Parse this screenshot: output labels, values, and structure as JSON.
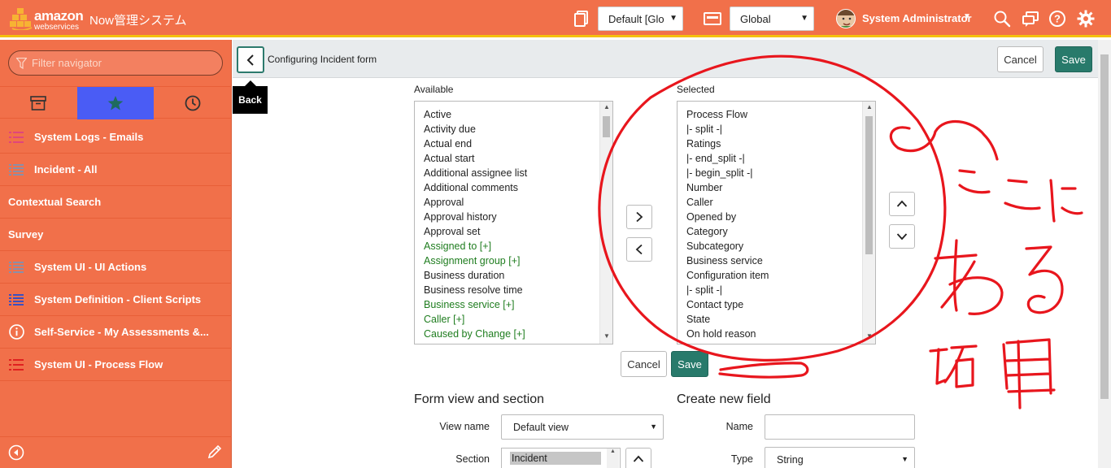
{
  "header": {
    "logo_word": "amazon",
    "logo_sub": "webservices",
    "app_title": "Now管理システム",
    "update_set": "Default [Glo",
    "application_scope": "Global",
    "user_name": "System Administrator"
  },
  "sidebar": {
    "filter_placeholder": "Filter navigator",
    "tabs": [
      {
        "icon": "archive-icon"
      },
      {
        "icon": "star-icon",
        "active": true
      },
      {
        "icon": "clock-icon"
      }
    ],
    "items": [
      {
        "label": "System Logs - Emails",
        "icon": "list-icon",
        "icon_color": "#e0457b"
      },
      {
        "label": "Incident - All",
        "icon": "list-icon",
        "icon_color": "#8a8fa8"
      },
      {
        "label": "Contextual Search",
        "icon": ""
      },
      {
        "label": "Survey",
        "icon": ""
      },
      {
        "label": "System UI - UI Actions",
        "icon": "list-icon",
        "icon_color": "#8a8fa8"
      },
      {
        "label": "System Definition - Client Scripts",
        "icon": "list-icon",
        "icon_color": "#3b4fc0"
      },
      {
        "label": "Self-Service - My Assessments &...",
        "icon": "info-icon",
        "icon_color": "#ffffff"
      },
      {
        "label": "System UI - Process Flow",
        "icon": "list-icon",
        "icon_color": "#e02020"
      }
    ]
  },
  "main": {
    "back_tooltip": "Back",
    "form_title": "Configuring Incident form",
    "cancel_label": "Cancel",
    "save_label": "Save",
    "available_label": "Available",
    "selected_label": "Selected",
    "available": [
      {
        "text": "Active",
        "ref": false
      },
      {
        "text": "Activity due",
        "ref": false
      },
      {
        "text": "Actual end",
        "ref": false
      },
      {
        "text": "Actual start",
        "ref": false
      },
      {
        "text": "Additional assignee list",
        "ref": false
      },
      {
        "text": "Additional comments",
        "ref": false
      },
      {
        "text": "Approval",
        "ref": false
      },
      {
        "text": "Approval history",
        "ref": false
      },
      {
        "text": "Approval set",
        "ref": false
      },
      {
        "text": "Assigned to [+]",
        "ref": true
      },
      {
        "text": "Assignment group [+]",
        "ref": true
      },
      {
        "text": "Business duration",
        "ref": false
      },
      {
        "text": "Business resolve time",
        "ref": false
      },
      {
        "text": "Business service [+]",
        "ref": true
      },
      {
        "text": "Caller [+]",
        "ref": true
      },
      {
        "text": "Caused by Change [+]",
        "ref": true
      }
    ],
    "selected": [
      "Process Flow",
      "|- split -|",
      "Ratings",
      "|- end_split -|",
      "|- begin_split -|",
      "Number",
      "Caller",
      "Opened by",
      "Category",
      "Subcategory",
      "Business service",
      "Configuration item",
      "|- split -|",
      "Contact type",
      "State",
      "On hold reason"
    ],
    "form_view_heading": "Form view and section",
    "view_name_label": "View name",
    "view_name_value": "Default view",
    "section_label": "Section",
    "section_value": "Incident",
    "create_field_heading": "Create new field",
    "name_label": "Name",
    "name_value": "",
    "type_label": "Type",
    "type_value": "String"
  },
  "colors": {
    "header_bg": "#f1704a",
    "accent_bar": "#f4c00e",
    "primary_button": "#287a6b",
    "active_tab": "#4a5cf5",
    "reference_field": "#1f7d1f",
    "annotation": "#e8161d"
  }
}
